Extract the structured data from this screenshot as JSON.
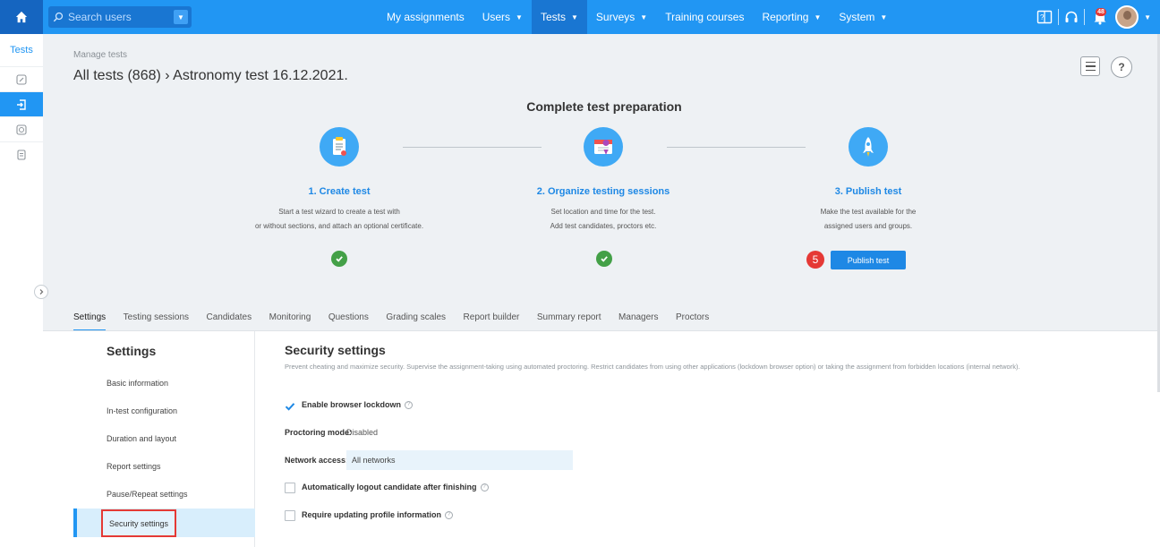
{
  "topbar": {
    "search_placeholder": "Search users",
    "nav": [
      {
        "label": "My assignments",
        "caret": false,
        "active": false
      },
      {
        "label": "Users",
        "caret": true,
        "active": false
      },
      {
        "label": "Tests",
        "caret": true,
        "active": true
      },
      {
        "label": "Surveys",
        "caret": true,
        "active": false
      },
      {
        "label": "Training courses",
        "caret": false,
        "active": false
      },
      {
        "label": "Reporting",
        "caret": true,
        "active": false
      },
      {
        "label": "System",
        "caret": true,
        "active": false
      }
    ],
    "notification_count": "48"
  },
  "sidebar": {
    "title": "Tests",
    "items": [
      "edit-icon",
      "login-arrow-icon",
      "gauge-icon",
      "document-icon"
    ]
  },
  "header": {
    "breadcrumb_small": "Manage tests",
    "title": "All tests (868) › Astronomy test 16.12.2021."
  },
  "preparation": {
    "title": "Complete test preparation",
    "steps": [
      {
        "title": "1. Create test",
        "line1": "Start a test wizard to create a test with",
        "line2": "or without sections, and attach an optional certificate.",
        "icon": "clipboard-icon",
        "completed": true
      },
      {
        "title": "2. Organize testing sessions",
        "line1": "Set location and time for the test.",
        "line2": "Add test candidates, proctors etc.",
        "icon": "calendar-pin-icon",
        "completed": true
      },
      {
        "title": "3. Publish test",
        "line1": "Make the test available for the",
        "line2": "assigned users and groups.",
        "icon": "rocket-icon",
        "completed": false
      }
    ],
    "step_marker": "5",
    "publish_button": "Publish test"
  },
  "tabs": [
    "Settings",
    "Testing sessions",
    "Candidates",
    "Monitoring",
    "Questions",
    "Grading scales",
    "Report builder",
    "Summary report",
    "Managers",
    "Proctors"
  ],
  "settings_nav": {
    "heading": "Settings",
    "items": [
      "Basic information",
      "In-test configuration",
      "Duration and layout",
      "Report settings",
      "Pause/Repeat settings",
      "Security settings"
    ],
    "active": "Security settings"
  },
  "security": {
    "title": "Security settings",
    "description": "Prevent cheating and maximize security. Supervise the assignment-taking using automated proctoring. Restrict candidates from using other applications (lockdown browser option) or taking the assignment from forbidden locations (internal network).",
    "browser_lockdown_label": "Enable browser lockdown",
    "browser_lockdown_checked": true,
    "proctoring_label": "Proctoring mode:",
    "proctoring_value": "Disabled",
    "network_label": "Network access:",
    "network_value": "All networks",
    "logout_label": "Automatically logout candidate after finishing",
    "logout_checked": false,
    "profile_label": "Require updating profile information",
    "profile_checked": false
  },
  "colors": {
    "primary": "#2196f3",
    "success": "#43a047",
    "alert": "#e53935"
  }
}
